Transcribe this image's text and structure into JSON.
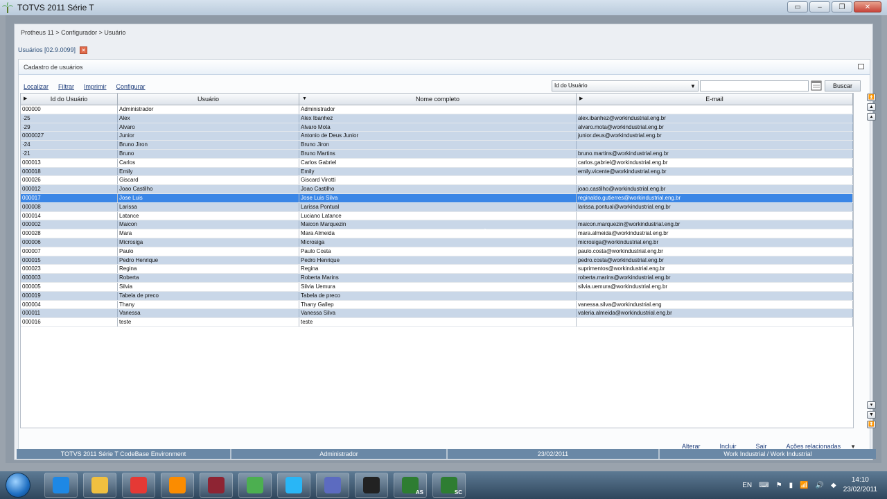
{
  "window": {
    "title": "TOTVS 2011 Série T"
  },
  "breadcrumb": "Protheus 11 > Configurador > Usuário",
  "tab": {
    "label": "Usuários [02.9.0099]"
  },
  "panel": {
    "title": "Cadastro de usuários"
  },
  "toolbar": {
    "locate": "Localizar",
    "filter": "Filtrar",
    "print": "Imprimir",
    "configure": "Configurar"
  },
  "search": {
    "field": "Id do Usuário",
    "value": "",
    "button": "Buscar"
  },
  "grid": {
    "columns": [
      "Id do Usuário",
      "Usuário",
      "Nome completo",
      "E-mail"
    ],
    "rows": [
      [
        "000000",
        "Administrador",
        "Administrador",
        ""
      ],
      [
        "·25",
        "Alex",
        "Alex Ibanhez",
        "alex.ibanhez@workindustrial.eng.br"
      ],
      [
        "·29",
        "Alvaro",
        "Alvaro Mota",
        "alvaro.mota@workindustrial.eng.br"
      ],
      [
        "0000027",
        "Junior",
        "Antonio de Deus Junior",
        "junior.deus@workindustrial.eng.br"
      ],
      [
        "·24",
        "Bruno Jiron",
        "Bruno Jiron",
        ""
      ],
      [
        "·21",
        "Bruno",
        "Bruno Martins",
        "bruno.martins@workindustrial.eng.br"
      ],
      [
        "000013",
        "Carlos",
        "Carlos Gabriel",
        "carlos.gabriel@workindustrial.eng.br"
      ],
      [
        "000018",
        "Emily",
        "Emily",
        "emily.vicente@workindustrial.eng.br"
      ],
      [
        "000026",
        "Giscard",
        "Giscard Virotti",
        ""
      ],
      [
        "000012",
        "Joao Castilho",
        "Joao Castilho",
        "joao.castilho@workindustrial.eng.br"
      ],
      [
        "000017",
        "Jose Luis",
        "Jose Luis Silva",
        "reginaldo.gutierres@workindustrial.eng.br"
      ],
      [
        "000008",
        "Larissa",
        "Larissa Pontual",
        "larissa.pontual@workindustrial.eng.br"
      ],
      [
        "000014",
        "Latance",
        "Luciano Latance",
        ""
      ],
      [
        "000002",
        "Maicon",
        "Maicon Marquezin",
        "maicon.marquezin@workindustrial.eng.br"
      ],
      [
        "000028",
        "Mara",
        "Mara Almeida",
        "mara.almeida@workindustrial.eng.br"
      ],
      [
        "000006",
        "Microsiga",
        "Microsiga",
        "microsiga@workindustrial.eng.br"
      ],
      [
        "000007",
        "Paulo",
        "Paulo Costa",
        "paulo.costa@workindustrial.eng.br"
      ],
      [
        "000015",
        "Pedro Henrique",
        "Pedro Henrique",
        "pedro.costa@workindustrial.eng.br"
      ],
      [
        "000023",
        "Regina",
        "Regina",
        "suprimentos@workindustrial.eng.br"
      ],
      [
        "000003",
        "Roberta",
        "Roberta Marins",
        "roberta.marins@workindustrial.eng.br"
      ],
      [
        "000005",
        "Silvia",
        "Silvia Uemura",
        "silvia.uemura@workindustrial.eng.br"
      ],
      [
        "000019",
        "Tabela de preco",
        "Tabela de preco",
        ""
      ],
      [
        "000004",
        "Thany",
        "Thany Gallep",
        "vanessa.silva@workindustrial.eng"
      ],
      [
        "000011",
        "Vanessa",
        "Vanessa Silva",
        "valeria.almeida@workindustrial.eng.br"
      ],
      [
        "000016",
        "teste",
        "teste",
        ""
      ]
    ],
    "selected_row": 10
  },
  "actions": {
    "edit": "Alterar",
    "add": "Incluir",
    "exit": "Sair",
    "related": "Ações relacionadas"
  },
  "statusbar": [
    "TOTVS 2011 Série T  CodeBase Environment",
    "Administrador",
    "23/02/2011",
    "Work Industrial / Work Industrial"
  ],
  "taskbar": {
    "items": [
      "ie-icon",
      "explorer-icon",
      "chrome-icon",
      "media-player-icon",
      "winrar-icon",
      "users-icon",
      "skype-icon",
      "remote-desktop-icon",
      "inkscape-icon",
      "totvs-as-icon",
      "totvs-sc-icon"
    ],
    "labels": {
      "as": "AS",
      "sc": "SC"
    },
    "lang": "EN",
    "time": "14:10",
    "date": "23/02/2011"
  },
  "colors": {
    "selected_row": "#3a86e6",
    "alt_row": "#c9d7e8",
    "statusbar": "#6a88a6"
  }
}
